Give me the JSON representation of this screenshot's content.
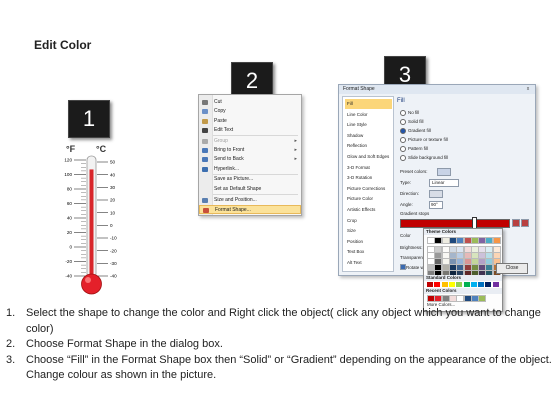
{
  "title": "Edit Color",
  "badges": [
    "1",
    "2",
    "3"
  ],
  "thermometer": {
    "unit_f": "°F",
    "unit_c": "°C",
    "f_ticks": [
      "120",
      "100",
      "80",
      "60",
      "40",
      "20",
      "0",
      "-20",
      "-40"
    ],
    "c_ticks": [
      "50",
      "40",
      "30",
      "20",
      "10",
      "0",
      "-10",
      "-20",
      "-30",
      "-40"
    ],
    "fill_fraction": 0.92,
    "colors": {
      "liquid": "#d8262b",
      "bulb": "#e4202a",
      "tube": "#f2f2f2"
    }
  },
  "context_menu": {
    "items": [
      {
        "label": "Cut",
        "icon": "scissors-icon",
        "color": "#777"
      },
      {
        "label": "Copy",
        "icon": "copy-icon",
        "color": "#6a8fc7"
      },
      {
        "label": "Paste",
        "icon": "paste-icon",
        "color": "#c29a4a"
      },
      {
        "label": "Edit Text",
        "icon": "edit-text-icon",
        "color": "#444"
      },
      {
        "label": "Group",
        "icon": "group-icon",
        "color": "#aaa",
        "disabled": true,
        "submenu": true
      },
      {
        "label": "Bring to Front",
        "icon": "bring-front-icon",
        "color": "#4a78b8",
        "submenu": true
      },
      {
        "label": "Send to Back",
        "icon": "send-back-icon",
        "color": "#4a78b8",
        "submenu": true
      },
      {
        "label": "Hyperlink...",
        "icon": "hyperlink-icon",
        "color": "#3c6fb0"
      },
      {
        "label": "Save as Picture...",
        "icon": "",
        "color": ""
      },
      {
        "label": "Set as Default Shape",
        "icon": "",
        "color": ""
      },
      {
        "label": "Size and Position...",
        "icon": "size-icon",
        "color": "#5a7fb0"
      },
      {
        "label": "Format Shape...",
        "icon": "format-shape-icon",
        "color": "#c84f3a",
        "highlighted": true
      }
    ]
  },
  "format_dialog": {
    "title": "Format Shape",
    "close_glyph": "x",
    "nav": [
      "Fill",
      "Line Color",
      "Line Style",
      "Shadow",
      "Reflection",
      "Glow and Soft Edges",
      "3-D Format",
      "3-D Rotation",
      "Picture Corrections",
      "Picture Color",
      "Artistic Effects",
      "Crop",
      "Size",
      "Position",
      "Text Box",
      "Alt Text"
    ],
    "selected_nav": "Fill",
    "pane_heading": "Fill",
    "fill_options": [
      "No fill",
      "Solid fill",
      "Gradient fill",
      "Picture or texture fill",
      "Pattern fill",
      "Slide background fill"
    ],
    "selected_fill": "Gradient fill",
    "preset_label": "Preset colors:",
    "type_label": "Type:",
    "type_value": "Linear",
    "direction_label": "Direction:",
    "angle_label": "Angle:",
    "angle_value": "90°",
    "stops_label": "Gradient stops",
    "color_label": "Color",
    "position_label": "Position:",
    "position_value": "67%",
    "brightness_label": "Brightness:",
    "transparency_label": "Transparency:",
    "rotate_label": "Rotate w",
    "close_button": "Close",
    "gradient_color": "#c00000"
  },
  "palette": {
    "theme_label": "Theme Colors",
    "standard_label": "Standard Colors",
    "recent_label": "Recent Colors",
    "more_label": "More Colors...",
    "theme_top": [
      "#ffffff",
      "#000000",
      "#eeece1",
      "#1f497d",
      "#4f81bd",
      "#c0504d",
      "#9bbb59",
      "#8064a2",
      "#4bacc6",
      "#f79646"
    ],
    "standard": [
      "#c00000",
      "#ff0000",
      "#ffc000",
      "#ffff00",
      "#92d050",
      "#00b050",
      "#00b0f0",
      "#0070c0",
      "#002060",
      "#7030a0"
    ],
    "recent": [
      "#c00000",
      "#e4202a",
      "#7f7f7f",
      "#f2dcdb",
      "#ffffff",
      "#1f497d",
      "#4f81bd",
      "#9bbb59"
    ]
  },
  "steps": [
    {
      "num": "1.",
      "text": "Select the shape to change the color and Right click the object( click any object which you want to change color)"
    },
    {
      "num": "2.",
      "text": "Choose Format Shape in the dialog box."
    },
    {
      "num": "3.",
      "text": "Choose “Fill” in the Format Shape box then “Solid” or “Gradient” depending on the appearance of the object. Change colour as shown in the picture."
    }
  ]
}
